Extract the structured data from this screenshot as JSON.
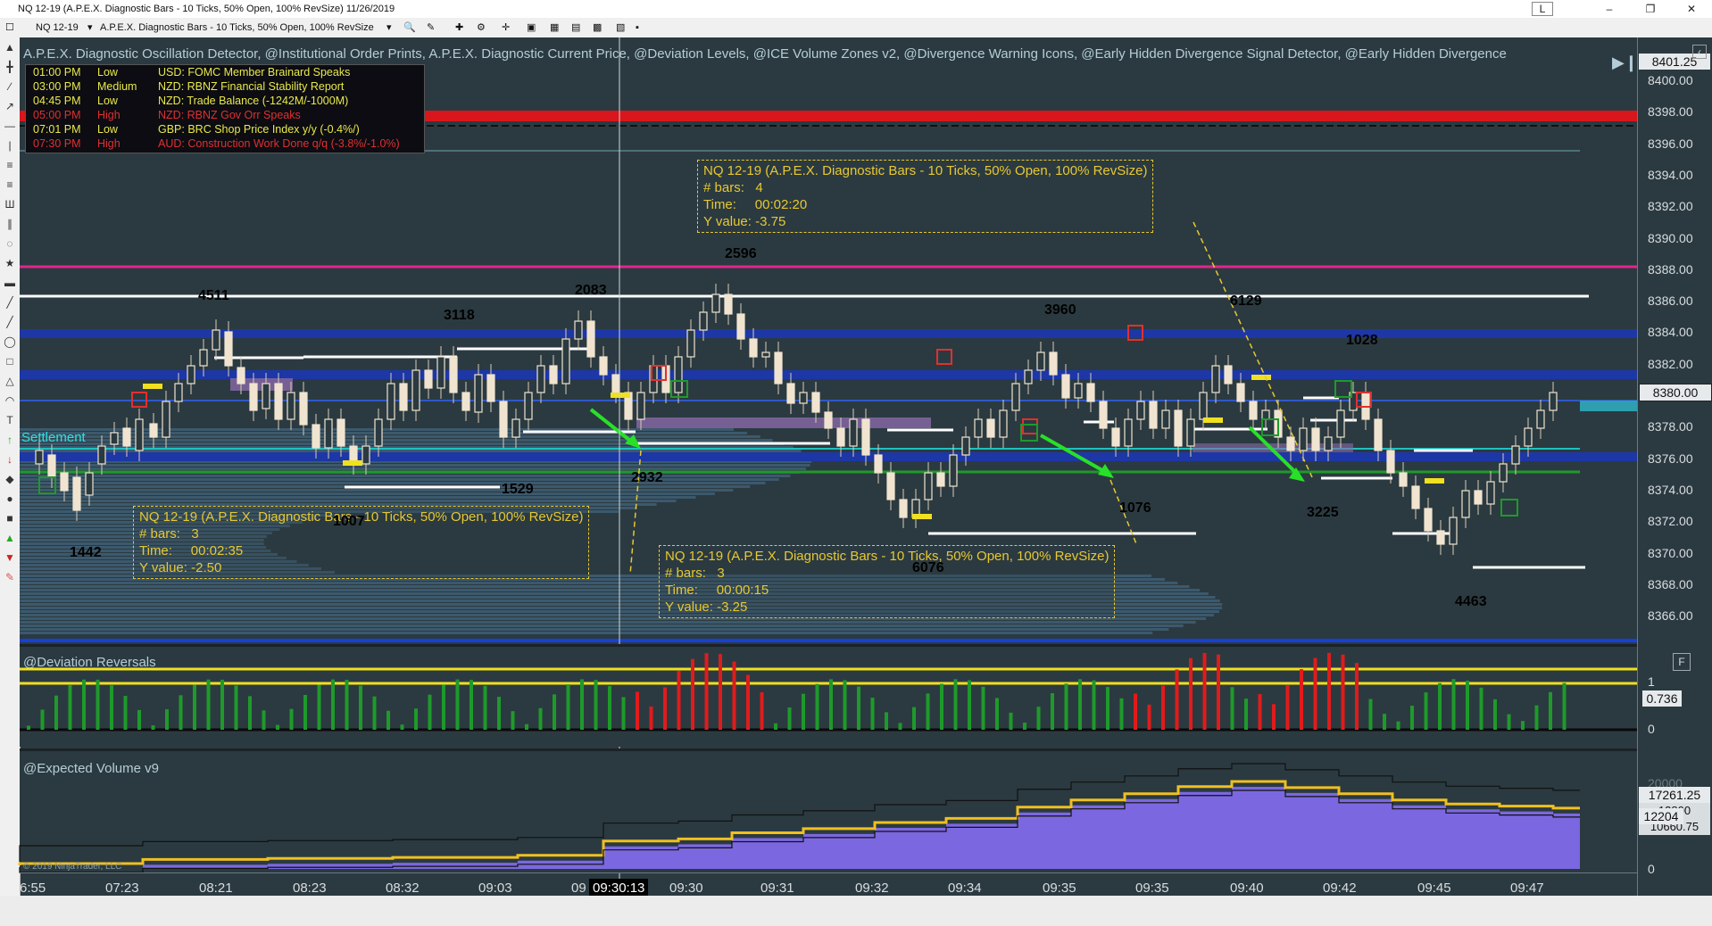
{
  "window": {
    "title": "NQ 12-19 (A.P.E.X. Diagnostic Bars - 10 Ticks, 50% Open, 100% RevSize)  11/26/2019",
    "mode_button": "L"
  },
  "toolbar": {
    "instrument": "NQ 12-19",
    "bar_type": "A.P.E.X. Diagnostic Bars - 10 Ticks, 50% Open, 100% RevSize"
  },
  "indicators_header": "A.P.E.X. Diagnostic Oscillation Detector, @Institutional Order Prints, A.P.E.X. Diagnostic Current Price, @Deviation Levels, @ICE Volume Zones v2, @Divergence Warning Icons, @Early Hidden Divergence Signal Detector, @Early Hidden Divergence",
  "events": [
    {
      "time": "01:00 PM",
      "impact": "Low",
      "text": "USD: FOMC Member Brainard Speaks",
      "color": "#e9e94a"
    },
    {
      "time": "03:00 PM",
      "impact": "Medium",
      "text": "NZD: RBNZ Financial Stability Report",
      "color": "#e9e94a"
    },
    {
      "time": "04:45 PM",
      "impact": "Low",
      "text": "NZD: Trade Balance (-1242M/-1000M)",
      "color": "#e9e94a"
    },
    {
      "time": "05:00 PM",
      "impact": "High",
      "text": "NZD: RBNZ Gov Orr Speaks",
      "color": "#e03030"
    },
    {
      "time": "07:01 PM",
      "impact": "Low",
      "text": "GBP: BRC Shop Price Index y/y (-0.4%/)",
      "color": "#e9e94a"
    },
    {
      "time": "07:30 PM",
      "impact": "High",
      "text": "AUD: Construction Work Done q/q (-3.8%/-1.0%)",
      "color": "#e03030"
    }
  ],
  "settlement_label": "Settlement",
  "price_axis": {
    "labels": [
      "8400.00",
      "8398.00",
      "8396.00",
      "8394.00",
      "8392.00",
      "8390.00",
      "8388.00",
      "8386.00",
      "8384.00",
      "8382.00",
      "8380.00",
      "8378.00",
      "8376.00",
      "8374.00",
      "8372.00",
      "8370.00",
      "8368.00",
      "8366.00"
    ],
    "top_tag": "8401.25",
    "current_price": "8380.00"
  },
  "tooltips": [
    {
      "title": "NQ 12-19 (A.P.E.X. Diagnostic Bars - 10 Ticks, 50% Open, 100% RevSize)",
      "bars_label": "# bars:",
      "bars": "4",
      "time_label": "Time:",
      "time": "00:02:20",
      "y_label": "Y value:",
      "y": "-3.75"
    },
    {
      "title": "NQ 12-19 (A.P.E.X. Diagnostic Bars - 10 Ticks, 50% Open, 100% RevSize)",
      "bars_label": "# bars:",
      "bars": "3",
      "time_label": "Time:",
      "time": "00:02:35",
      "y_label": "Y value:",
      "y": "-2.50"
    },
    {
      "title": "NQ 12-19 (A.P.E.X. Diagnostic Bars - 10 Ticks, 50% Open, 100% RevSize)",
      "bars_label": "# bars:",
      "bars": "3",
      "time_label": "Time:",
      "time": "00:00:15",
      "y_label": "Y value:",
      "y": "-3.25"
    }
  ],
  "volume_labels": [
    {
      "text": "4511",
      "color": "#ffffff"
    },
    {
      "text": "3118",
      "color": "#f0c020"
    },
    {
      "text": "2083",
      "color": "#ffffff"
    },
    {
      "text": "2596",
      "color": "#ffffff"
    },
    {
      "text": "3960",
      "color": "#111111"
    },
    {
      "text": "6129",
      "color": "#f0c020"
    },
    {
      "text": "1028",
      "color": "#111111"
    },
    {
      "text": "1442",
      "color": "#111111"
    },
    {
      "text": "1007",
      "color": "#111111"
    },
    {
      "text": "1529",
      "color": "#111111"
    },
    {
      "text": "2932",
      "color": "#f0c020"
    },
    {
      "text": "6076",
      "color": "#ffffff"
    },
    {
      "text": "1076",
      "color": "#111111"
    },
    {
      "text": "3225",
      "color": "#f0c020"
    },
    {
      "text": "4463",
      "color": "#ffffff"
    }
  ],
  "time_axis": {
    "labels": [
      "6:55",
      "07:23",
      "08:21",
      "08:23",
      "08:32",
      "09:03",
      "09",
      "09:30",
      "09:31",
      "09:32",
      "09:34",
      "09:35",
      "09:35",
      "09:40",
      "09:42",
      "09:45",
      "09:47"
    ],
    "cursor_time": "09:30:13"
  },
  "deviation_pane": {
    "title": "@Deviation Reversals",
    "value_tag": "0.736",
    "axis_labels": [
      "1",
      "0"
    ],
    "button": "F"
  },
  "volume_pane": {
    "title": "@Expected Volume v9",
    "axis_labels": [
      "20000",
      "0"
    ],
    "tag_high": "17261.25",
    "tag_mid": "12204",
    "tag_back1": "13800",
    "tag_back2": "10660.75"
  },
  "copyright": "© 2019 NinjaTrader, LLC",
  "colors": {
    "background": "#2b3a40",
    "up_bar": "#f0e4d0",
    "down_bar": "#f0e4d0",
    "red_level": "#d8161c",
    "magenta_level": "#e0268c",
    "blue_zone": "#1d37a6",
    "yellow": "#f0c020",
    "green_osc": "#1e9a2a",
    "red_osc": "#e11b1b",
    "volume_fill": "#7b68e0"
  }
}
